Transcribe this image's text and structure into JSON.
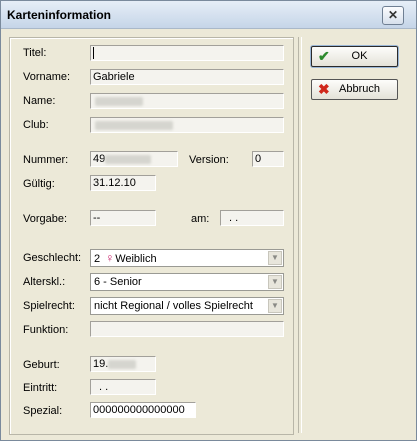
{
  "window": {
    "title": "Karteninformation",
    "close_label": "✕"
  },
  "labels": {
    "titel": "Titel:",
    "vorname": "Vorname:",
    "name": "Name:",
    "club": "Club:",
    "nummer": "Nummer:",
    "version": "Version:",
    "gueltig": "Gültig:",
    "vorgabe": "Vorgabe:",
    "am": "am:",
    "geschlecht": "Geschlecht:",
    "alterskl": "Alterskl.:",
    "spielrecht": "Spielrecht:",
    "funktion": "Funktion:",
    "geburt": "Geburt:",
    "eintritt": "Eintritt:",
    "spezial": "Spezial:"
  },
  "values": {
    "titel": "",
    "vorname": "Gabriele",
    "name": "",
    "club": "",
    "nummer": "49",
    "version": "0",
    "gueltig": "31.12.10",
    "vorgabe": "--",
    "am": ". .",
    "geschlecht_code": "2",
    "geschlecht_text": "Weiblich",
    "alterskl": "6 - Senior",
    "spielrecht": "nicht Regional / volles Spielrecht",
    "funktion": "",
    "geburt": "19.",
    "eintritt": ". .",
    "spezial": "000000000000000"
  },
  "icons": {
    "female": "female-icon",
    "check": "checkmark-icon",
    "cancel": "x-icon"
  },
  "buttons": {
    "ok_label": "OK",
    "cancel_label": "Abbruch"
  }
}
